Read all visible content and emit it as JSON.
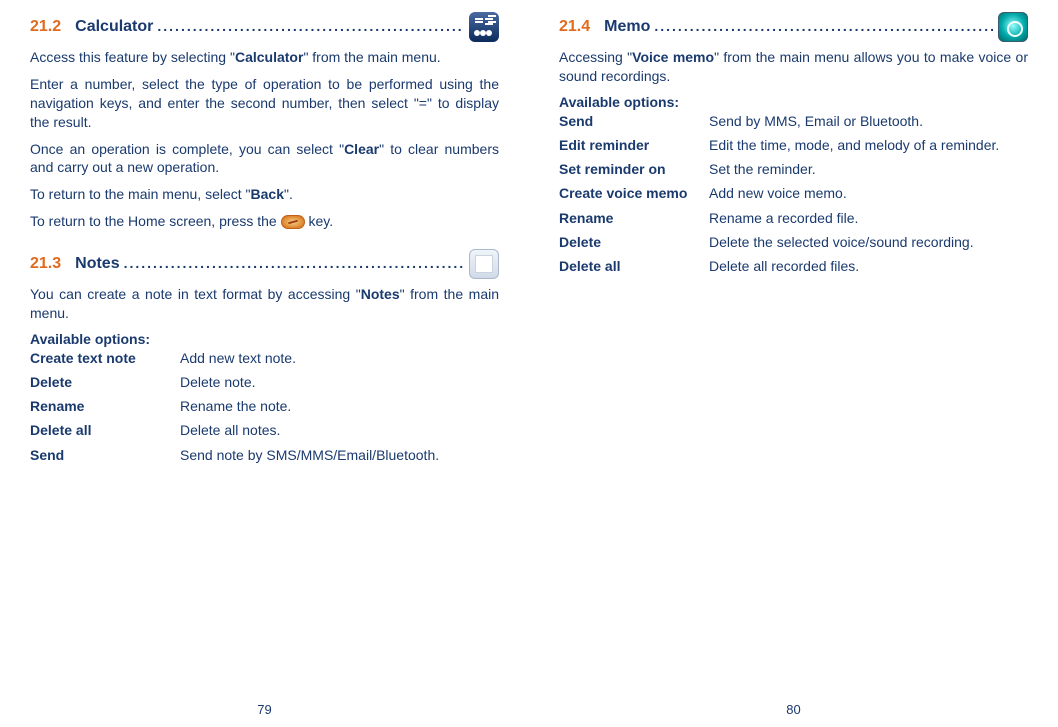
{
  "left": {
    "section1": {
      "number": "21.2",
      "title": "Calculator",
      "dots": "....................................................",
      "p1_a": "Access this feature by selecting \"",
      "p1_b": "Calculator",
      "p1_c": "\" from the main menu.",
      "p2": "Enter a number, select the type of operation to be performed using the navigation keys, and enter the second number, then select \"=\" to display the result.",
      "p3_a": "Once an operation is complete, you can select \"",
      "p3_b": "Clear",
      "p3_c": "\" to clear numbers and carry out a new operation.",
      "p4_a": "To return to the main menu, select \"",
      "p4_b": "Back",
      "p4_c": "\".",
      "p5_a": "To return to the Home screen, press the ",
      "p5_b": " key."
    },
    "section2": {
      "number": "21.3",
      "title": "Notes",
      "dots": "............................................................",
      "p1_a": "You can create a note in text format by accessing \"",
      "p1_b": "Notes",
      "p1_c": "\" from the main menu.",
      "options_title": "Available options:",
      "options": [
        {
          "label": "Create text note",
          "desc": "Add new text note."
        },
        {
          "label": "Delete",
          "desc": "Delete note."
        },
        {
          "label": "Rename",
          "desc": "Rename the note."
        },
        {
          "label": "Delete all",
          "desc": "Delete all notes."
        },
        {
          "label": "Send",
          "desc": "Send note by SMS/MMS/Email/Bluetooth."
        }
      ]
    },
    "page_num": "79"
  },
  "right": {
    "section1": {
      "number": "21.4",
      "title": "Memo",
      "dots": "............................................................",
      "p1_a": "Accessing \"",
      "p1_b": "Voice memo",
      "p1_c": "\" from the main menu allows you to make voice or sound recordings.",
      "options_title": "Available options:",
      "options": [
        {
          "label": "Send",
          "desc": "Send by MMS, Email or Bluetooth."
        },
        {
          "label": "Edit reminder",
          "desc": "Edit the time, mode, and melody of a reminder."
        },
        {
          "label": "Set reminder on",
          "desc": "Set the reminder."
        },
        {
          "label": "Create voice memo",
          "desc": "Add new voice memo."
        },
        {
          "label": "Rename",
          "desc": "Rename a recorded file."
        },
        {
          "label": "Delete",
          "desc": "Delete the selected voice/sound recording."
        },
        {
          "label": "Delete all",
          "desc": "Delete all recorded files."
        }
      ]
    },
    "page_num": "80"
  }
}
